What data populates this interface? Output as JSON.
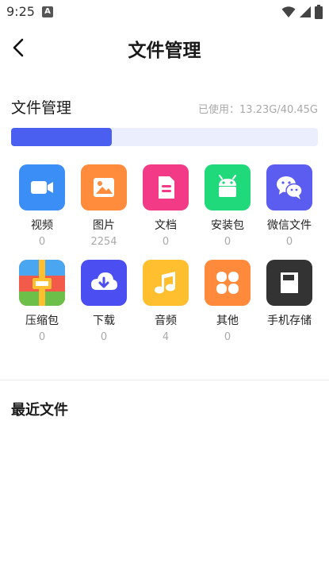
{
  "status": {
    "time": "9:25",
    "badge": "A"
  },
  "header": {
    "title": "文件管理"
  },
  "storage": {
    "label": "文件管理",
    "usage_text": "已使用：13.23G/40.45G",
    "used_fraction": 0.327
  },
  "categories": [
    {
      "label": "视频",
      "count": "0",
      "icon": "video-camera-icon",
      "color": "#3a8ef6"
    },
    {
      "label": "图片",
      "count": "2254",
      "icon": "image-icon",
      "color": "#ff8b3d"
    },
    {
      "label": "文档",
      "count": "0",
      "icon": "document-icon",
      "color": "#f23a86"
    },
    {
      "label": "安装包",
      "count": "0",
      "icon": "android-icon",
      "color": "#1fd97a"
    },
    {
      "label": "微信文件",
      "count": "0",
      "icon": "wechat-icon",
      "color": "#5b5cf0"
    },
    {
      "label": "压缩包",
      "count": "0",
      "icon": "archive-icon",
      "color": "#f25a4a"
    },
    {
      "label": "下载",
      "count": "0",
      "icon": "download-cloud-icon",
      "color": "#4b4ef0"
    },
    {
      "label": "音频",
      "count": "4",
      "icon": "music-note-icon",
      "color": "#ffbf2e"
    },
    {
      "label": "其他",
      "count": "0",
      "icon": "four-petal-icon",
      "color": "#ff8a3c"
    },
    {
      "label": "手机存储",
      "count": "",
      "icon": "sd-card-icon",
      "color": "#333333"
    }
  ],
  "recent": {
    "title": "最近文件"
  }
}
